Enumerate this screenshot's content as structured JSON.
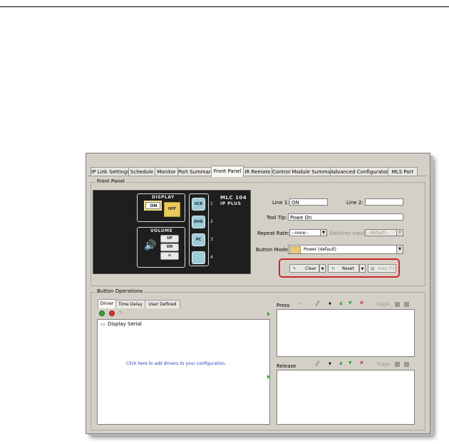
{
  "tabs": [
    "IP Link Settings",
    "Schedule",
    "Monitor",
    "Port Summary",
    "Front Panel",
    "IR Remote",
    "Control Module Summary",
    "Advanced Configuraton",
    "MLS Port"
  ],
  "front_panel": {
    "group_label": "Front Panel",
    "device": {
      "model_line1": "MLC 104",
      "model_line2": "IP PLUS",
      "display_label": "DISPLAY",
      "on_label": "ON",
      "off_label": "OFF",
      "volume_label": "VOLUME",
      "up_label": "UP",
      "dn_label": "DN",
      "inputs": [
        "VCR",
        "DVD",
        "PC",
        ""
      ],
      "input_numbers": [
        "1",
        "2",
        "3",
        "4"
      ]
    },
    "line1_label": "Line 1:",
    "line1_value": "ON",
    "line2_label": "Line 2:",
    "line2_value": "",
    "tooltip_label": "Tool Tip:",
    "tooltip_value": "Powe On",
    "repeat_rate_label": "Repeat Rate:",
    "repeat_rate_value": "--none--",
    "switcher_input_label": "Switcher Input:",
    "switcher_input_value": "--default--",
    "button_modes_label": "Button Modes:",
    "button_modes_value": "Power    (default)",
    "button_mode_color": "#e8c87a",
    "clear_label": "Clear",
    "reset_label": "Reset",
    "autofill_label": "Auto Fill"
  },
  "button_operations": {
    "group_label": "Button Operations",
    "tabs": [
      "Driver",
      "Time Delay",
      "User Defined"
    ],
    "tree_root": "Display Serial",
    "add_drivers_link": "Click here to add drivers to your configuration.",
    "press_label": "Press",
    "release_label": "Release",
    "toggle_label": "Toggle"
  },
  "colors": {
    "highlight": "#d0262a",
    "panel_bg": "#d4d0c8",
    "link": "#2a3ec0"
  }
}
